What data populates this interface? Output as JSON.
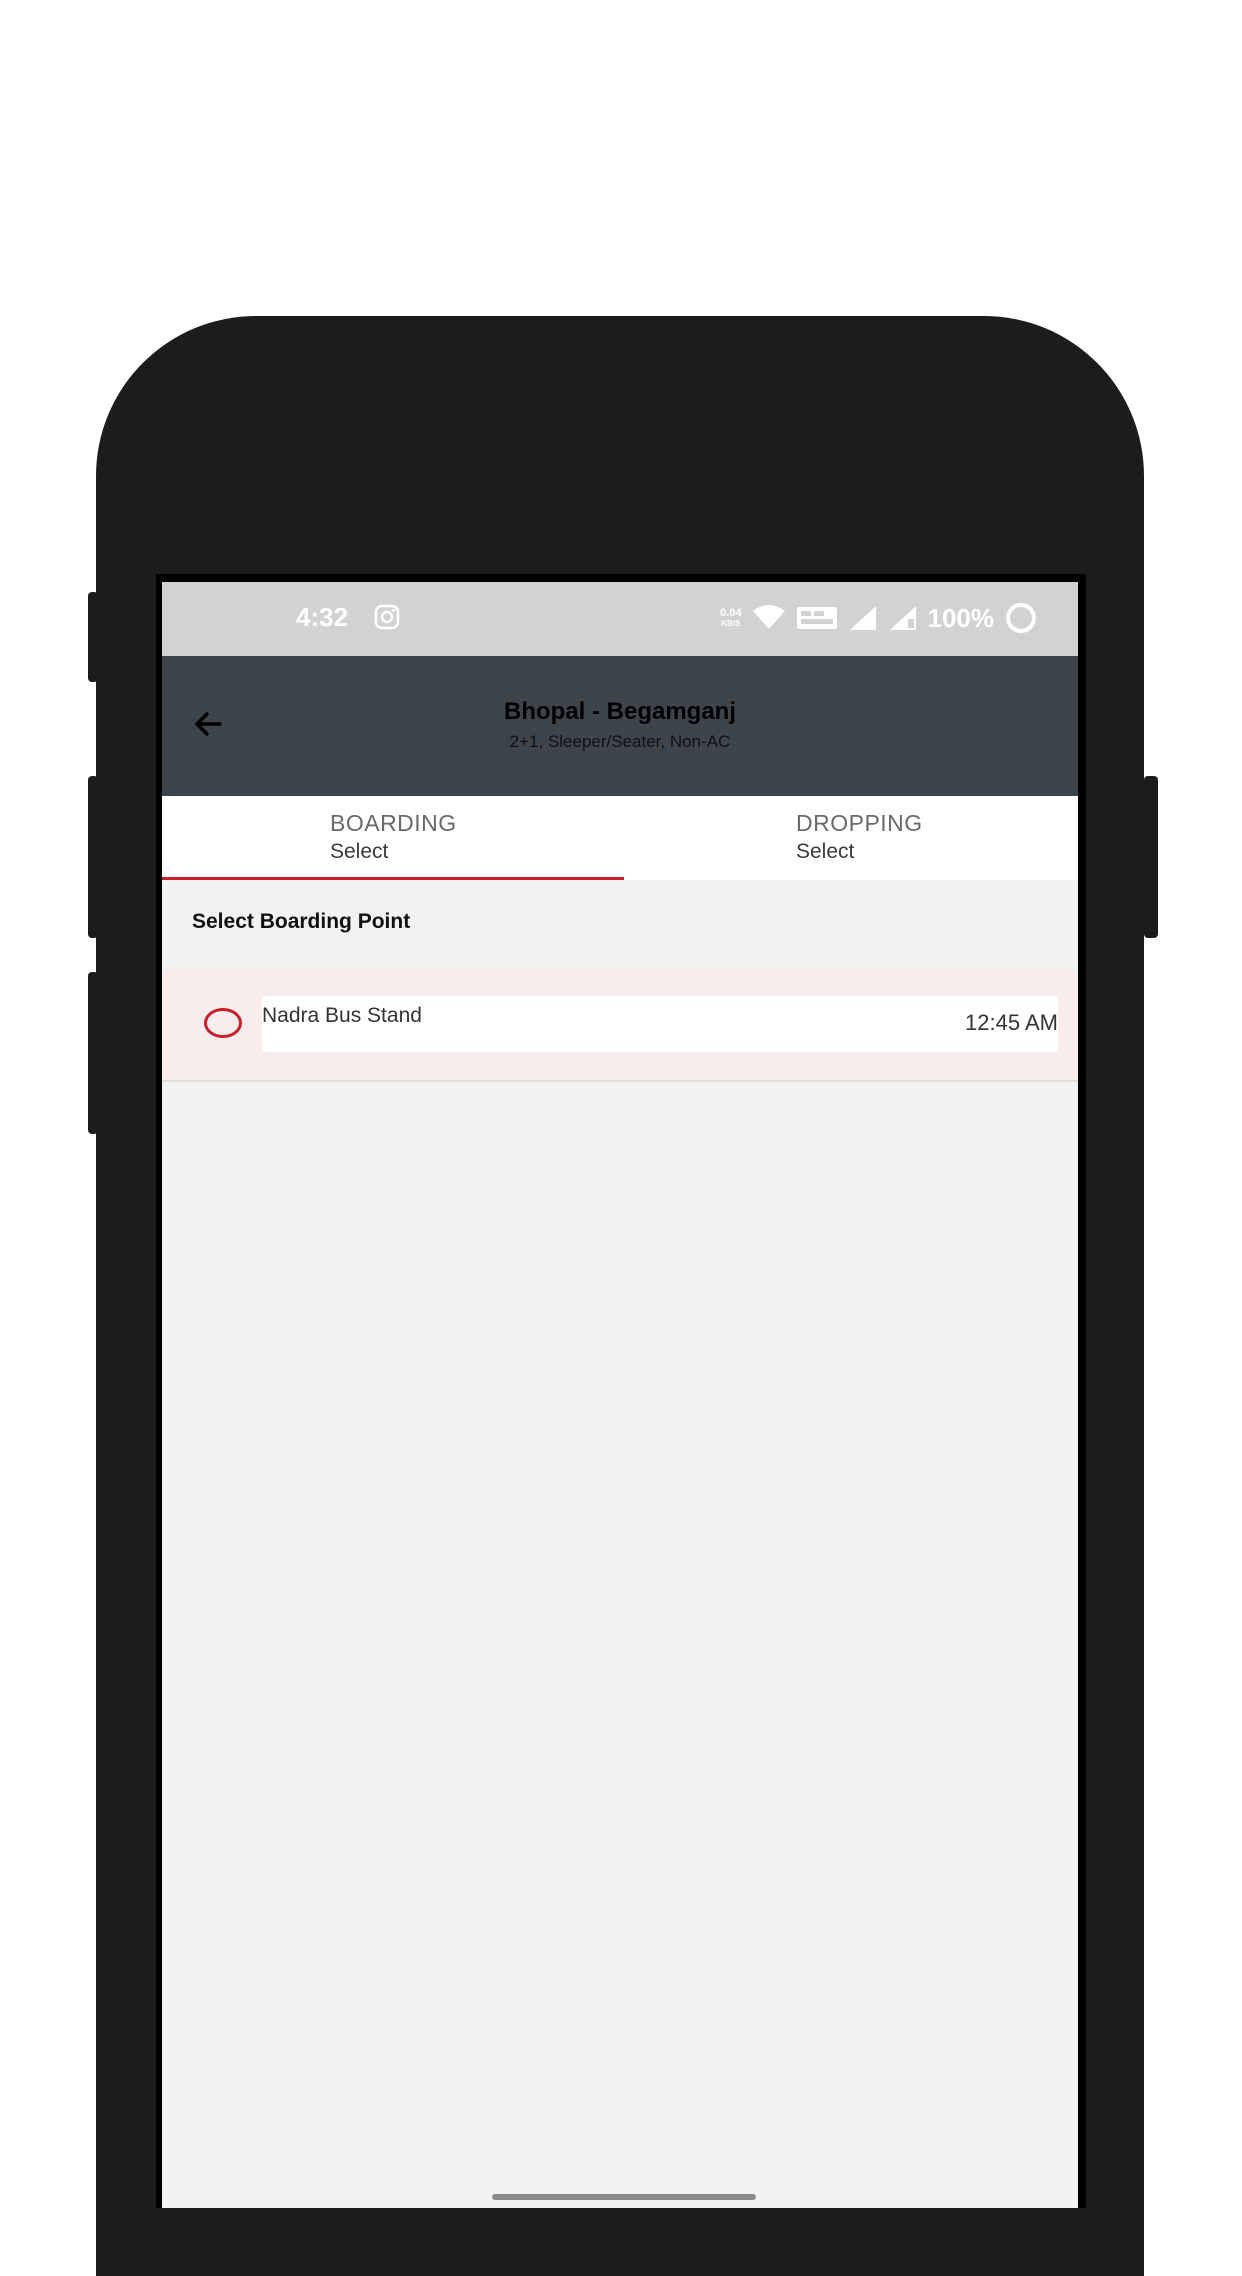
{
  "status_bar": {
    "time": "4:32",
    "net_speed_value": "0.04",
    "net_speed_unit": "KB/S",
    "battery": "100%"
  },
  "app_bar": {
    "title": "Bhopal - Begamganj",
    "subtitle": "2+1,  Sleeper/Seater, Non-AC"
  },
  "tabs": [
    {
      "title": "BOARDING",
      "value": "Select",
      "active": true
    },
    {
      "title": "DROPPING",
      "value": "Select",
      "active": false
    }
  ],
  "section_label": "Select Boarding Point",
  "boarding_points": [
    {
      "name": "Nadra Bus Stand",
      "time": "12:45 AM"
    }
  ],
  "colors": {
    "accent": "#c8202a",
    "app_bar_bg": "#3d454a",
    "status_bar_bg": "#d4d2d1",
    "screen_bg": "#f2f2f2",
    "row_highlight": "#f9eced"
  }
}
